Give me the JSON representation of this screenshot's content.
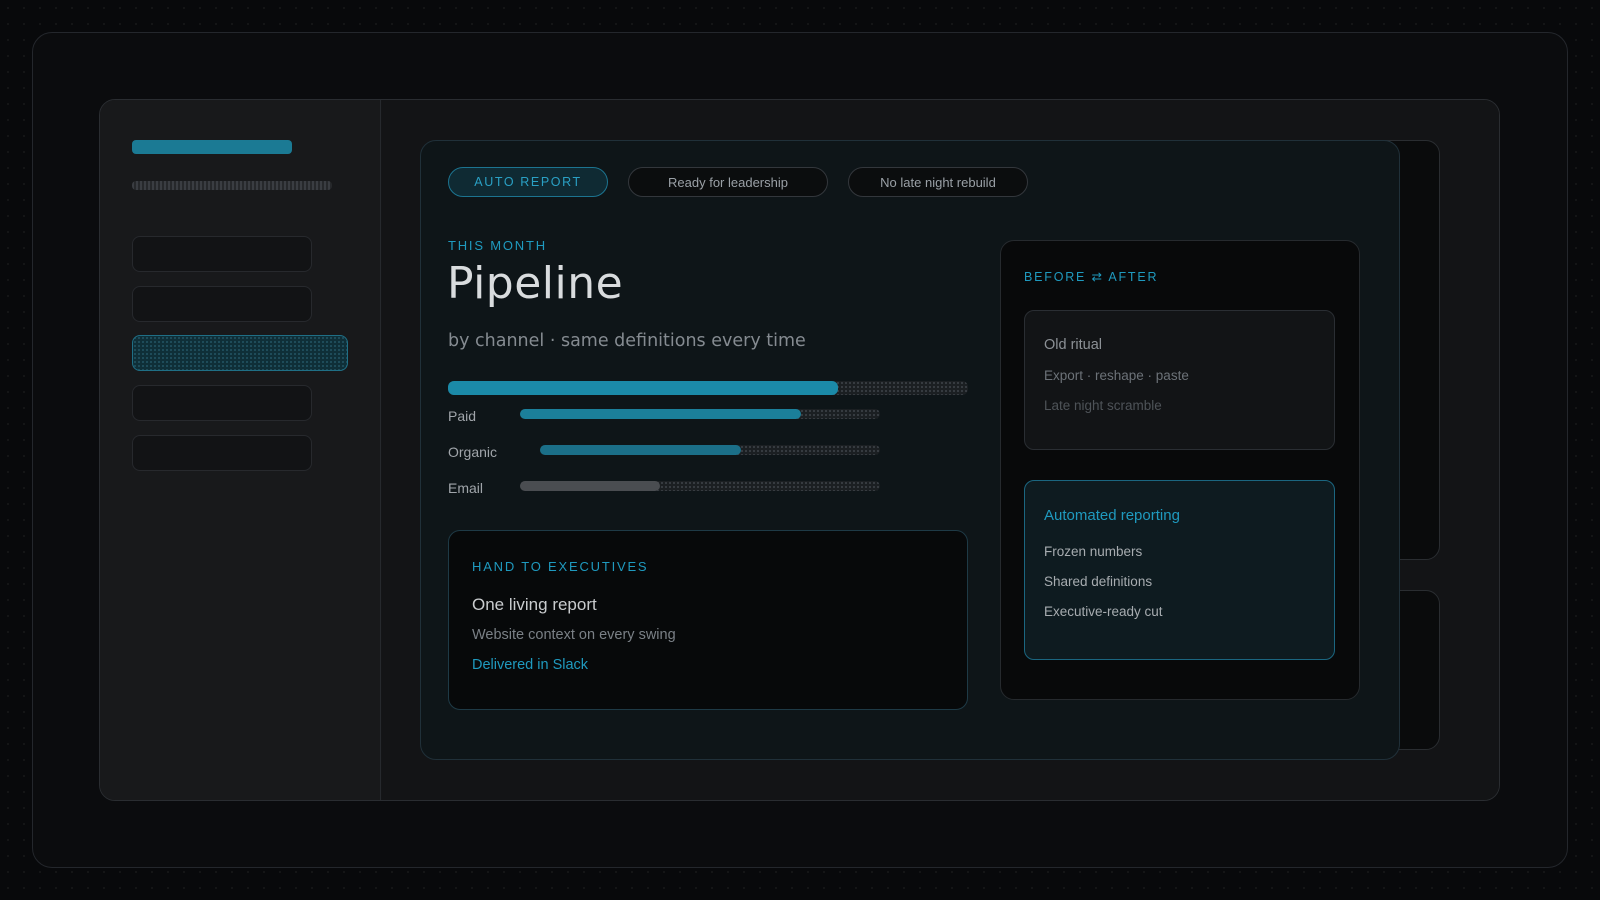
{
  "chips": {
    "auto_report": "AUTO REPORT",
    "ready": "Ready for leadership",
    "no_late_night": "No late night rebuild"
  },
  "header": {
    "eyebrow": "THIS MONTH",
    "title": "Pipeline",
    "subtitle": "by channel · same definitions every time"
  },
  "metrics": {
    "overall_progress": 0.75,
    "channels": [
      {
        "label": "Paid",
        "value": 0.78,
        "color": "#1b7f9a"
      },
      {
        "label": "Organic",
        "value": 0.59,
        "color": "#1b6f88"
      },
      {
        "label": "Email",
        "value": 0.39,
        "color": "#4a4d51"
      }
    ]
  },
  "exec_card": {
    "eyebrow": "HAND TO EXECUTIVES",
    "title": "One living report",
    "detail": "Website context on every swing",
    "link": "Delivered in Slack"
  },
  "before_after": {
    "eyebrow": "BEFORE ⇄ AFTER",
    "old": {
      "title": "Old ritual",
      "line1": "Export · reshape · paste",
      "line2": "Late night scramble"
    },
    "new": {
      "title": "Automated reporting",
      "items": [
        "Frozen numbers",
        "Shared definitions",
        "Executive-ready cut"
      ]
    }
  },
  "colors": {
    "accent": "#1f9abf",
    "accent_fill": "#1b7f9a",
    "background": "#08090b"
  }
}
